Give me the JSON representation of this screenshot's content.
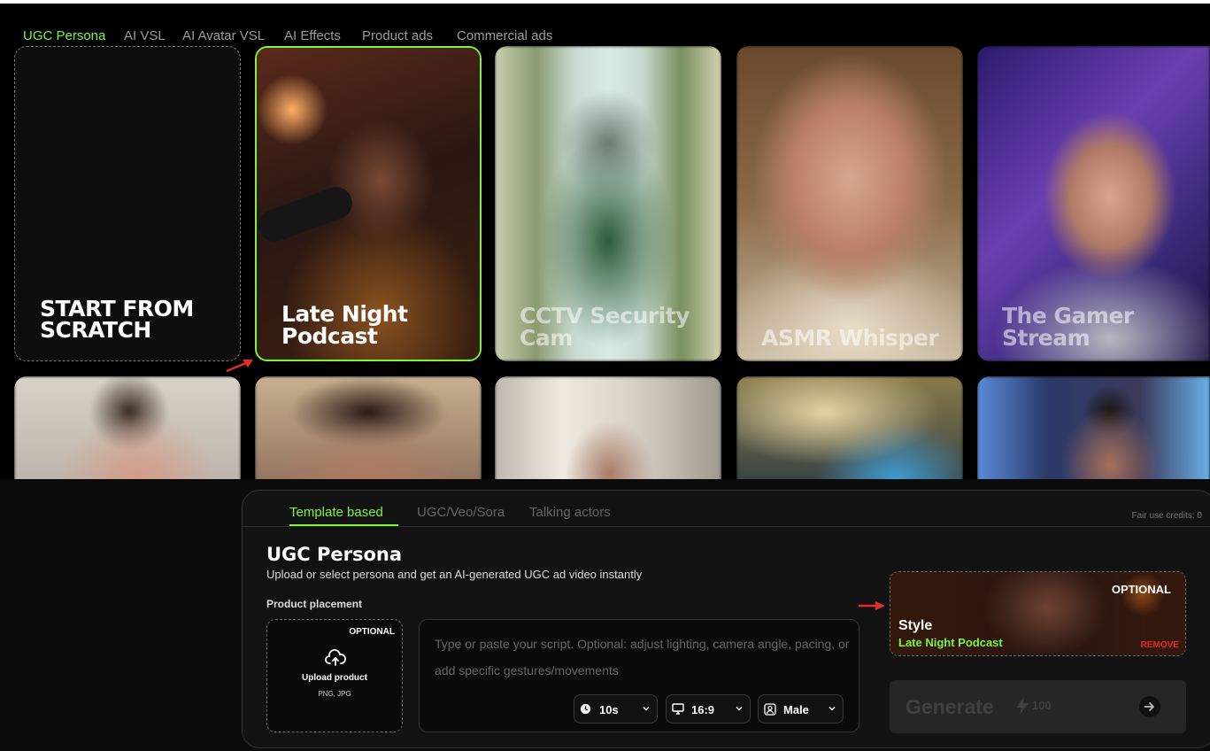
{
  "top_tabs": [
    "UGC Persona",
    "AI VSL",
    "AI Avatar VSL",
    "AI Effects",
    "Product ads",
    "Commercial ads"
  ],
  "scratch_label": "START FROM\nSCRATCH",
  "templates": [
    {
      "title": "Late Night\nPodcast"
    },
    {
      "title": "CCTV Security\nCam"
    },
    {
      "title": "ASMR Whisper"
    },
    {
      "title": "The Gamer\nStream"
    }
  ],
  "panel": {
    "tabs": [
      "Template based",
      "UGC/Veo/Sora",
      "Talking actors"
    ],
    "credits": "Fair use credits: 0",
    "title": "UGC Persona",
    "subtitle": "Upload or select persona and get an AI-generated UGC ad video instantly",
    "product_label": "Product placement",
    "upload": {
      "optional": "OPTIONAL",
      "label": "Upload product",
      "formats": "PNG, JPG"
    },
    "script_placeholder": "Type or paste your script. Optional: adjust lighting, camera angle, pacing, or add specific gestures/movements",
    "selects": {
      "duration": "10s",
      "aspect": "16:9",
      "gender": "Male"
    },
    "style": {
      "optional": "OPTIONAL",
      "label": "Style",
      "value": "Late Night Podcast",
      "remove": "REMOVE"
    },
    "generate": {
      "label": "Generate",
      "cost": "100"
    }
  },
  "colors": {
    "accent": "#7cf43a",
    "danger": "#e32b2b",
    "panel": "#121212"
  }
}
